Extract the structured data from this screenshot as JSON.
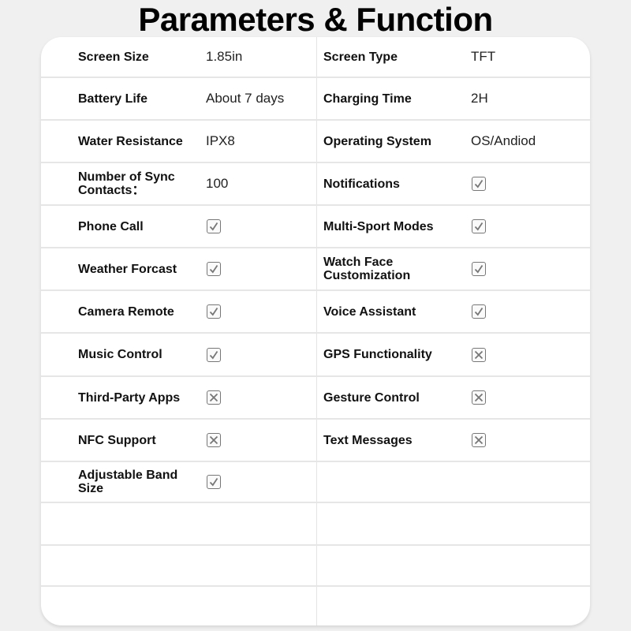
{
  "title": "Parameters & Function",
  "rows": [
    {
      "left": {
        "label": "Screen Size",
        "value": "1.85in"
      },
      "right": {
        "label": "Screen Type",
        "value": "TFT"
      }
    },
    {
      "left": {
        "label": "Battery Life",
        "value": "About 7 days"
      },
      "right": {
        "label": "Charging Time",
        "value": "2H"
      }
    },
    {
      "left": {
        "label": "Water Resistance",
        "value": "IPX8"
      },
      "right": {
        "label": "Operating System",
        "value": "OS/Andiod"
      }
    },
    {
      "left": {
        "label": "Number of Sync Contacts：",
        "value": "100"
      },
      "right": {
        "label": "Notifications",
        "check": "yes"
      }
    },
    {
      "left": {
        "label": "Phone Call",
        "check": "yes"
      },
      "right": {
        "label": "Multi-Sport Modes",
        "check": "yes"
      }
    },
    {
      "left": {
        "label": "Weather Forcast",
        "check": "yes"
      },
      "right": {
        "label": "Watch Face Customization",
        "check": "yes"
      }
    },
    {
      "left": {
        "label": "Camera Remote",
        "check": "yes"
      },
      "right": {
        "label": "Voice Assistant",
        "check": "yes"
      }
    },
    {
      "left": {
        "label": "Music Control",
        "check": "yes"
      },
      "right": {
        "label": "GPS Functionality",
        "check": "no"
      }
    },
    {
      "left": {
        "label": "Third-Party Apps",
        "check": "no"
      },
      "right": {
        "label": "Gesture Control",
        "check": "no"
      }
    },
    {
      "left": {
        "label": "NFC Support",
        "check": "no"
      },
      "right": {
        "label": "Text Messages",
        "check": "no"
      }
    },
    {
      "left": {
        "label": "Adjustable Band Size",
        "check": "yes"
      },
      "right": {}
    },
    {
      "left": {},
      "right": {}
    },
    {
      "left": {},
      "right": {}
    },
    {
      "left": {},
      "right": {}
    }
  ]
}
